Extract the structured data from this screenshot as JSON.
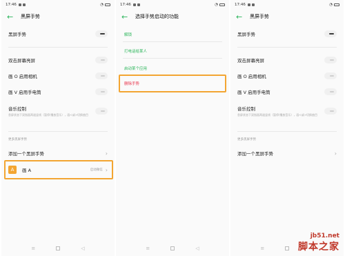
{
  "status": {
    "time": "17:46"
  },
  "screen1": {
    "title": "黑屏手势",
    "main_toggle_label": "黑屏手势",
    "rows": [
      {
        "label": "双击屏幕亮屏"
      },
      {
        "label": "画 O 启用相机"
      },
      {
        "label": "画 V 启用手电筒"
      },
      {
        "label": "音乐控制"
      }
    ],
    "music_desc": "息屏状态下双指画两道竖线（暂停/播放音乐），画<或>切换曲目",
    "section_label": "更多黑屏手势",
    "add_gesture": "添加一个黑屏手势",
    "gesture_item": {
      "icon": "A",
      "label": "画 A",
      "value": "启动微信"
    }
  },
  "screen2": {
    "title": "选择手势启动的功能",
    "options": [
      "解锁",
      "打电话给某人",
      "启动某个应用",
      "删除手势"
    ]
  },
  "screen3": {
    "title": "黑屏手势",
    "main_toggle_label": "黑屏手势",
    "rows": [
      {
        "label": "双击屏幕亮屏"
      },
      {
        "label": "画 O 启用相机"
      },
      {
        "label": "画 V 启用手电筒"
      },
      {
        "label": "音乐控制"
      }
    ],
    "music_desc": "息屏状态下双指画两道竖线（暂停/播放音乐），画<或>切换曲目",
    "section_label": "更多黑屏手势",
    "add_gesture": "添加一个黑屏手势"
  },
  "nav": {
    "back": "◁",
    "home": "○",
    "menu": "≡"
  },
  "watermark": {
    "site": "jb51.net",
    "brand": "脚本之家"
  },
  "colors": {
    "accent": "#2bb55a",
    "highlight": "#f3a531",
    "danger": "#e8334a"
  }
}
